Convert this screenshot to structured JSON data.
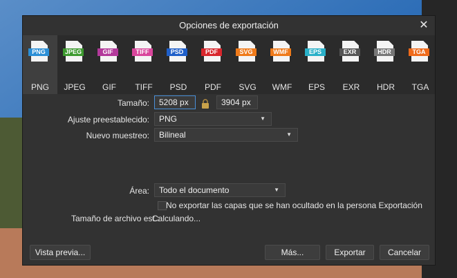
{
  "dialog": {
    "title": "Opciones de exportación",
    "close_label": "✕"
  },
  "formats": [
    {
      "label": "PNG",
      "tag": "PNG",
      "color": "#2b8fd6",
      "selected": true
    },
    {
      "label": "JPEG",
      "tag": "JPEG",
      "color": "#3d9a2f",
      "selected": false
    },
    {
      "label": "GIF",
      "tag": "GIF",
      "color": "#b3399b",
      "selected": false
    },
    {
      "label": "TIFF",
      "tag": "TIFF",
      "color": "#d9469c",
      "selected": false
    },
    {
      "label": "PSD",
      "tag": "PSD",
      "color": "#1f5fc9",
      "selected": false
    },
    {
      "label": "PDF",
      "tag": "PDF",
      "color": "#d8262c",
      "selected": false
    },
    {
      "label": "SVG",
      "tag": "SVG",
      "color": "#ef7a1a",
      "selected": false
    },
    {
      "label": "WMF",
      "tag": "WMF",
      "color": "#ef7a1a",
      "selected": false
    },
    {
      "label": "EPS",
      "tag": "EPS",
      "color": "#2ab0c8",
      "selected": false
    },
    {
      "label": "EXR",
      "tag": "EXR",
      "color": "#555555",
      "selected": false
    },
    {
      "label": "HDR",
      "tag": "HDR",
      "color": "#777777",
      "selected": false
    },
    {
      "label": "TGA",
      "tag": "TGA",
      "color": "#ef6a1a",
      "selected": false
    }
  ],
  "size": {
    "label": "Tamaño:",
    "width": "5208 px",
    "height": "3904 px"
  },
  "preset": {
    "label": "Ajuste preestablecido:",
    "value": "PNG"
  },
  "resample": {
    "label": "Nuevo muestreo:",
    "value": "Bilineal"
  },
  "area": {
    "label": "Área:",
    "value": "Todo el documento"
  },
  "hidden_layers": {
    "label": "No exportar las capas que se han ocultado en la persona Exportación",
    "checked": false
  },
  "file_size": {
    "label": "Tamaño de archivo est.:",
    "value": "Calculando..."
  },
  "buttons": {
    "preview": "Vista previa...",
    "more": "Más...",
    "export": "Exportar",
    "cancel": "Cancelar"
  }
}
